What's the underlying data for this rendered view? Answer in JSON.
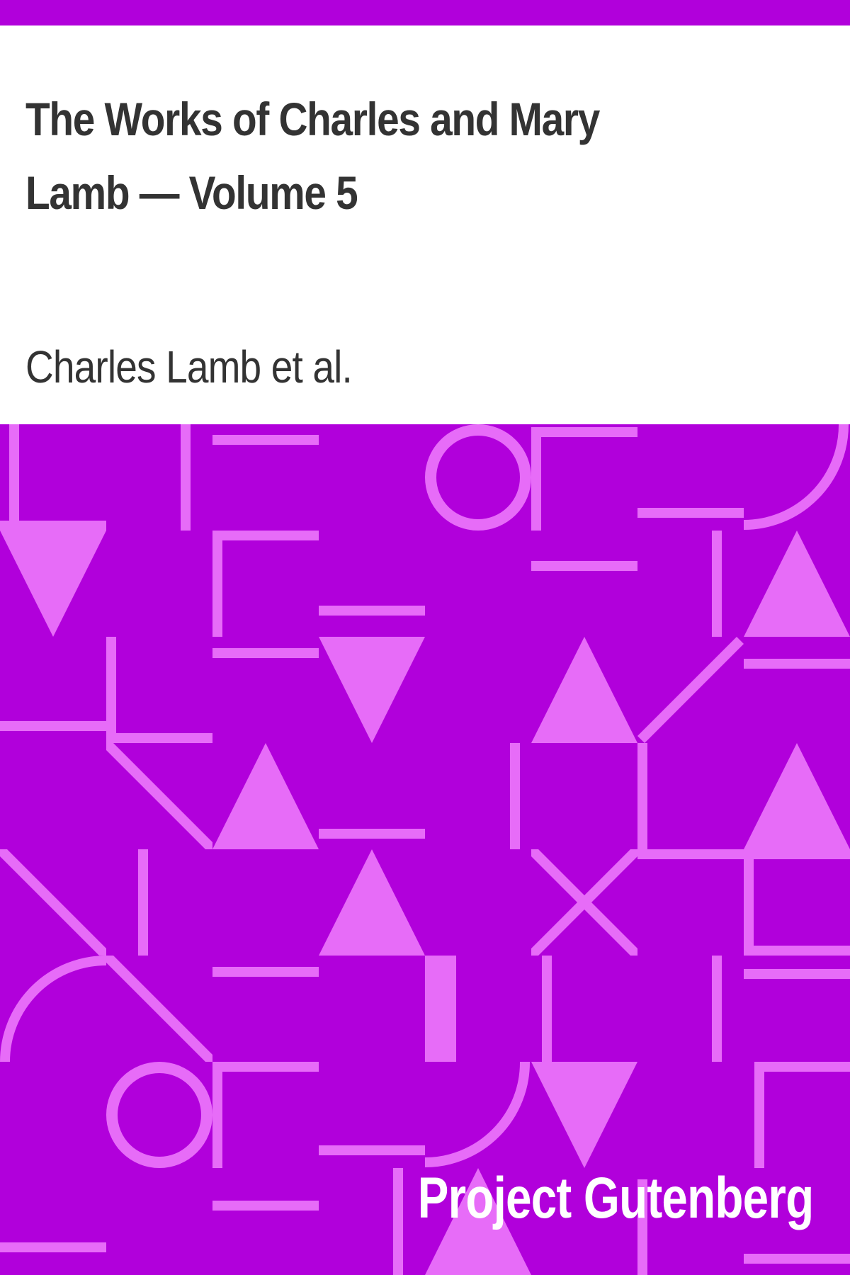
{
  "cover": {
    "title": "The Works of Charles and Mary Lamb — Volume 5",
    "author": "Charles Lamb et al.",
    "publisher": "Project Gutenberg"
  },
  "colors": {
    "background": "#ffffff",
    "primary": "#b100db",
    "shape": "#e76cf8",
    "text": "#333333",
    "publisher_text": "#ffffff"
  }
}
